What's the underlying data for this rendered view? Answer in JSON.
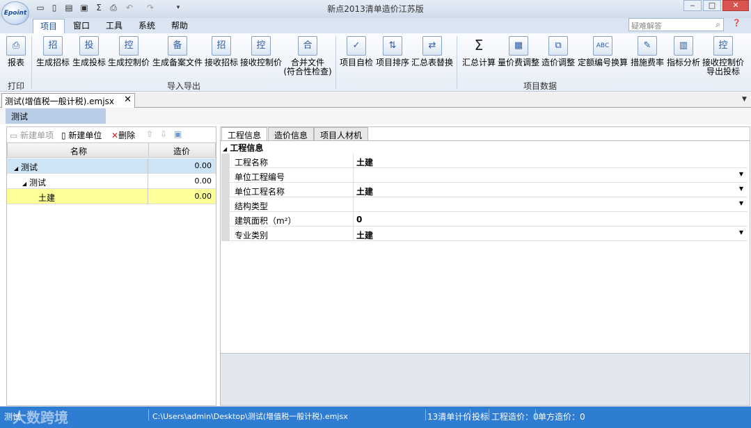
{
  "app": {
    "title": "新点2013清单造价江苏版",
    "logo_text": "Epoint"
  },
  "menu": {
    "tabs": [
      "项目",
      "窗口",
      "工具",
      "系统",
      "帮助"
    ],
    "active": 0
  },
  "search": {
    "placeholder": "疑难解答"
  },
  "ribbon": {
    "buttons": [
      {
        "label": "报表",
        "icon": "printer-icon"
      },
      {
        "label": "生成招标",
        "icon": "export-doc-icon"
      },
      {
        "label": "生成投标",
        "icon": "export-doc-icon"
      },
      {
        "label": "生成控制价",
        "icon": "export-doc-icon"
      },
      {
        "label": "生成备案文件",
        "icon": "export-doc-icon"
      },
      {
        "label": "接收招标",
        "icon": "import-doc-icon"
      },
      {
        "label": "接收控制价",
        "icon": "import-doc-icon"
      },
      {
        "label": "合并文件",
        "label2": "(符合性检查)",
        "icon": "merge-doc-icon"
      },
      {
        "label": "项目自检",
        "icon": "check-doc-icon"
      },
      {
        "label": "项目排序",
        "icon": "sort-icon"
      },
      {
        "label": "汇总表替换",
        "icon": "replace-icon"
      },
      {
        "label": "汇总计算",
        "icon": "sigma-icon"
      },
      {
        "label": "量价费调整",
        "icon": "table-adjust-icon"
      },
      {
        "label": "造价调整",
        "icon": "copy-adjust-icon"
      },
      {
        "label": "定额编号换算",
        "icon": "abc-icon"
      },
      {
        "label": "措施费率",
        "icon": "pencil-doc-icon"
      },
      {
        "label": "指标分析",
        "icon": "chart-icon"
      },
      {
        "label": "接收控制价",
        "label2": "导出投标",
        "icon": "import-doc-icon"
      }
    ],
    "groups": [
      "打印",
      "导入导出",
      "项目数据"
    ]
  },
  "document": {
    "tab_title": "测试(增值税一般计税).emjsx",
    "breadcrumb": "测试"
  },
  "left_toolbar": {
    "new_item": "新建单项",
    "new_unit": "新建单位",
    "delete": "删除"
  },
  "tree": {
    "headers": [
      "名称",
      "造价"
    ],
    "rows": [
      {
        "name": "测试",
        "value": "0.00",
        "level": 0
      },
      {
        "name": "测试",
        "value": "0.00",
        "level": 1
      },
      {
        "name": "土建",
        "value": "0.00",
        "level": 2
      }
    ]
  },
  "right_tabs": [
    "工程信息",
    "造价信息",
    "项目人材机"
  ],
  "info": {
    "group_title": "工程信息",
    "rows": [
      {
        "key": "工程名称",
        "value": "土建",
        "dropdown": false
      },
      {
        "key": "单位工程编号",
        "value": "",
        "dropdown": true
      },
      {
        "key": "单位工程名称",
        "value": "土建",
        "dropdown": true
      },
      {
        "key": "结构类型",
        "value": "",
        "dropdown": true
      },
      {
        "key": "建筑面积（m²）",
        "value": "0",
        "dropdown": false
      },
      {
        "key": "专业类别",
        "value": "土建",
        "dropdown": true
      }
    ]
  },
  "status": {
    "left": "测试",
    "path": "C:\\Users\\admin\\Desktop\\测试(增值税一般计税).emjsx",
    "mode": "13清单计价",
    "type": "投标",
    "cost": "工程造价：0",
    "unit_cost": "单方造价：0",
    "watermark": "大数跨境"
  },
  "colors": {
    "statusbar": "#2f7cd3",
    "selected_row": "#ffff99",
    "tree_highlight": "#cde4f7",
    "breadcrumb": "#b9cde6"
  }
}
